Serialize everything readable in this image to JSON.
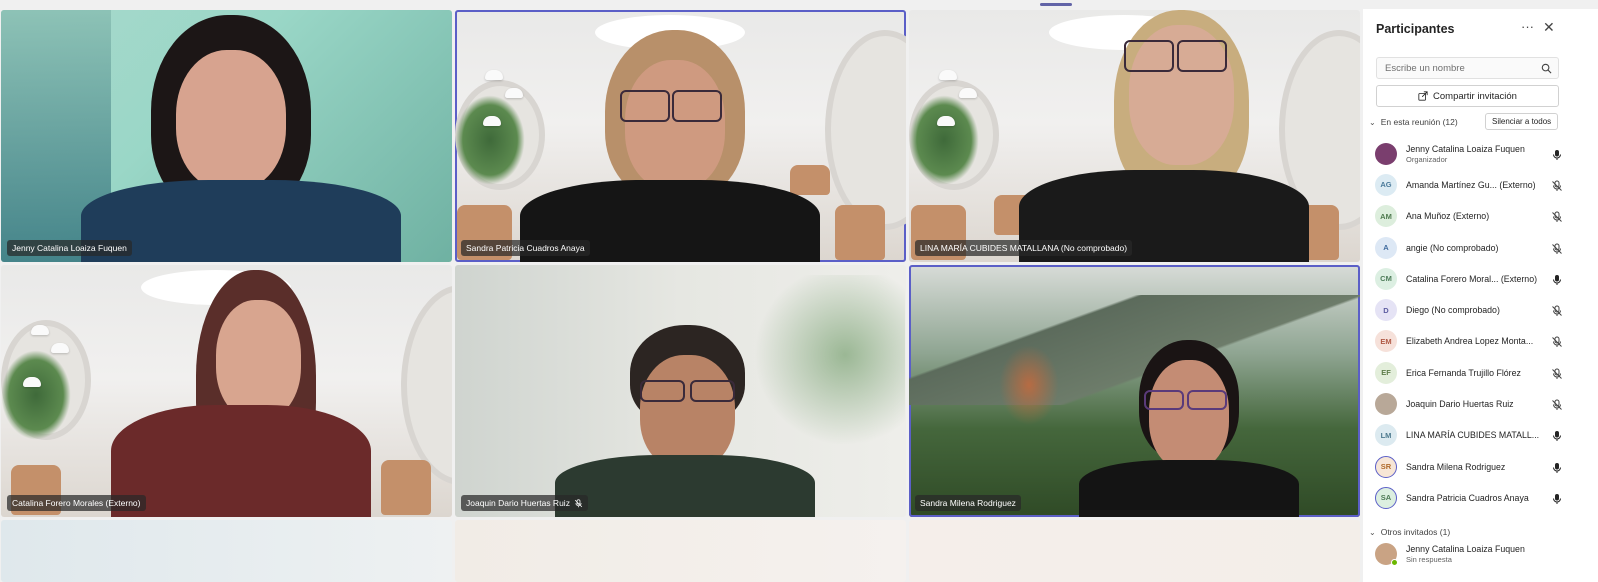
{
  "meeting": {
    "tiles": [
      {
        "name": "Jenny Catalina Loaiza Fuquen",
        "mic_muted": false,
        "active": false
      },
      {
        "name": "Sandra Patricia Cuadros Anaya",
        "mic_muted": false,
        "active": true
      },
      {
        "name": "LINA MARÍA CUBIDES MATALLANA (No comprobado)",
        "mic_muted": false,
        "active": false
      },
      {
        "name": "Catalina Forero Morales (Externo)",
        "mic_muted": false,
        "active": false
      },
      {
        "name": "Joaquin Dario Huertas Ruiz",
        "mic_muted": true,
        "active": false
      },
      {
        "name": "Sandra Milena Rodriguez",
        "mic_muted": false,
        "active": true
      }
    ]
  },
  "participants_panel": {
    "title": "Participantes",
    "search_placeholder": "Escribe un nombre",
    "share_label": "Compartir invitación",
    "in_meeting_label": "En esta reunión (12)",
    "mute_all_label": "Silenciar a todos",
    "people": [
      {
        "name": "Jenny Catalina Loaiza Fuquen",
        "subtitle": "Organizador",
        "initials": "",
        "avatar_color": "#7a3e6e",
        "avatar_bg": "#7a3e6e",
        "mic": "on"
      },
      {
        "name": "Amanda Martínez Gu... (Externo)",
        "subtitle": "",
        "initials": "AG",
        "avatar_color": "#4a7a9a",
        "avatar_bg": "#dcebf3",
        "mic": "off"
      },
      {
        "name": "Ana Muñoz (Externo)",
        "subtitle": "",
        "initials": "AM",
        "avatar_color": "#4f7a4f",
        "avatar_bg": "#ddeedd",
        "mic": "off"
      },
      {
        "name": "angie (No comprobado)",
        "subtitle": "",
        "initials": "A",
        "avatar_color": "#3e6a9e",
        "avatar_bg": "#dde8f5",
        "mic": "off"
      },
      {
        "name": "Catalina Forero Moral... (Externo)",
        "subtitle": "",
        "initials": "CM",
        "avatar_color": "#4e7d5a",
        "avatar_bg": "#dcefe2",
        "mic": "on"
      },
      {
        "name": "Diego (No comprobado)",
        "subtitle": "",
        "initials": "D",
        "avatar_color": "#5c5ca0",
        "avatar_bg": "#e5e3f5",
        "mic": "off"
      },
      {
        "name": "Elizabeth Andrea Lopez Monta...",
        "subtitle": "",
        "initials": "EM",
        "avatar_color": "#b05a46",
        "avatar_bg": "#f6e1da",
        "mic": "off"
      },
      {
        "name": "Erica Fernanda Trujillo Flórez",
        "subtitle": "",
        "initials": "EF",
        "avatar_color": "#5f7d4a",
        "avatar_bg": "#e3eedb",
        "mic": "off"
      },
      {
        "name": "Joaquin Dario Huertas Ruiz",
        "subtitle": "",
        "initials": "",
        "avatar_color": "#8a7a6a",
        "avatar_bg": "#b8a898",
        "mic": "off"
      },
      {
        "name": "LINA MARÍA CUBIDES MATALL...",
        "subtitle": "",
        "initials": "LM",
        "avatar_color": "#4d7a8e",
        "avatar_bg": "#dceaf0",
        "mic": "on"
      },
      {
        "name": "Sandra Milena Rodriguez",
        "subtitle": "",
        "initials": "SR",
        "avatar_color": "#b06a2a",
        "avatar_bg": "#f7e6d6",
        "mic": "on",
        "ring": true
      },
      {
        "name": "Sandra Patricia Cuadros Anaya",
        "subtitle": "",
        "initials": "SA",
        "avatar_color": "#4e7a56",
        "avatar_bg": "#dcefe0",
        "mic": "on",
        "ring": true
      }
    ],
    "others_label": "Otros invitados (1)",
    "others": [
      {
        "name": "Jenny Catalina Loaiza Fuquen",
        "subtitle": "Sin respuesta"
      }
    ]
  },
  "colors": {
    "accent": "#5b5fc7",
    "panel_bg": "#ffffff"
  }
}
